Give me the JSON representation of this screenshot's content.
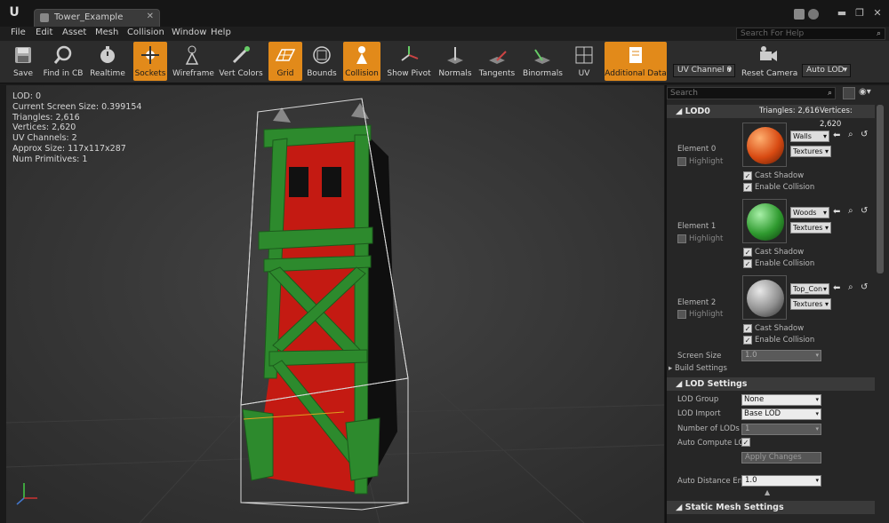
{
  "window": {
    "tab_title": "Tower_Example",
    "minimize": "▬",
    "maximize": "❐",
    "close": "✕"
  },
  "menu": [
    "File",
    "Edit",
    "Asset",
    "Mesh",
    "Collision",
    "Window",
    "Help"
  ],
  "help_search": {
    "placeholder": "Search For Help"
  },
  "toolbar": {
    "buttons": [
      {
        "label": "Save",
        "active": false
      },
      {
        "label": "Find in CB",
        "active": false
      },
      {
        "label": "Realtime",
        "active": false
      },
      {
        "label": "Sockets",
        "active": true
      },
      {
        "label": "Wireframe",
        "active": false
      },
      {
        "label": "Vert Colors",
        "active": false
      },
      {
        "label": "Grid",
        "active": true
      },
      {
        "label": "Bounds",
        "active": false
      },
      {
        "label": "Collision",
        "active": true
      },
      {
        "label": "Show Pivot",
        "active": false
      },
      {
        "label": "Normals",
        "active": false
      },
      {
        "label": "Tangents",
        "active": false
      },
      {
        "label": "Binormals",
        "active": false
      },
      {
        "label": "UV",
        "active": false
      },
      {
        "label": "Additional Data",
        "active": true
      },
      {
        "label": "Reset Camera",
        "active": false
      }
    ],
    "uv_channel": "UV Channel 0",
    "auto_lod": "Auto LOD"
  },
  "viewport": {
    "stats": [
      "LOD:  0",
      "Current Screen Size:  0.399154",
      "Triangles:  2,616",
      "Vertices:  2,620",
      "UV Channels:  2",
      "Approx Size: 117x117x287",
      "Num Primitives:  1"
    ]
  },
  "details": {
    "search_placeholder": "Search",
    "lod0": {
      "title": "LOD0",
      "triangles": "Triangles: 2,616",
      "vertices": "Vertices: 2,620",
      "elements": [
        {
          "name": "Element 0",
          "highlight": "Highlight",
          "material": "Walls",
          "textures": "Textures",
          "color": "#d84a12",
          "cast_shadow": "Cast Shadow",
          "enable_collision": "Enable Collision"
        },
        {
          "name": "Element 1",
          "highlight": "Highlight",
          "material": "Woods",
          "textures": "Textures",
          "color": "#2f9a2f",
          "cast_shadow": "Cast Shadow",
          "enable_collision": "Enable Collision"
        },
        {
          "name": "Element 2",
          "highlight": "Highlight",
          "material": "Top_Con",
          "textures": "Textures",
          "color": "#8f8f8f",
          "cast_shadow": "Cast Shadow",
          "enable_collision": "Enable Collision"
        }
      ],
      "screen_size_label": "Screen Size",
      "screen_size_value": "1.0",
      "build_settings": "Build Settings"
    },
    "lod_settings": {
      "title": "LOD Settings",
      "lod_group_label": "LOD Group",
      "lod_group_value": "None",
      "lod_import_label": "LOD Import",
      "lod_import_value": "Base LOD",
      "num_lods_label": "Number of LODs",
      "num_lods_value": "1",
      "auto_compute_label": "Auto Compute LOD",
      "apply_changes": "Apply Changes",
      "auto_distance_label": "Auto Distance Erro",
      "auto_distance_value": "1.0"
    },
    "static_mesh_settings": {
      "title": "Static Mesh Settings"
    }
  },
  "colors": {
    "accent": "#e28a1a",
    "tower_red": "#c41a12",
    "tower_green": "#2d8a2d"
  }
}
